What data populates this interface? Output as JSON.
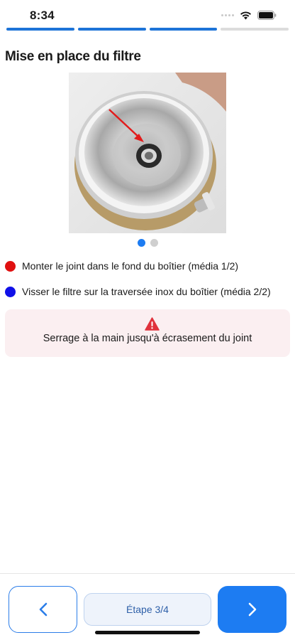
{
  "status_bar": {
    "time": "8:34"
  },
  "progress": {
    "total_steps": 4,
    "completed_steps": 3,
    "active_color": "#1d74d8",
    "inactive_color": "#dcdcdc"
  },
  "page": {
    "title": "Mise en place du filtre"
  },
  "media": {
    "image_description_icon": "photo-filter-housing",
    "pager": {
      "count": 2,
      "active_index": 0,
      "active_color": "#1d7cf2",
      "inactive_color": "#cfcfcf"
    }
  },
  "steps": [
    {
      "text": "Monter le joint dans le fond du boîtier (média 1/2)",
      "color": "#e01010"
    },
    {
      "text": "Visser le filtre sur la traversée inox du boîtier (média 2/2)",
      "color": "#1010e8"
    }
  ],
  "warning": {
    "icon": "warning-triangle-icon",
    "text": "Serrage à la main jusqu'à écrasement du joint",
    "color": "#e0323c"
  },
  "footer": {
    "prev_icon": "chevron-left-icon",
    "step_label": "Étape 3/4",
    "next_icon": "chevron-right-icon",
    "accent": "#1d7cf2"
  }
}
